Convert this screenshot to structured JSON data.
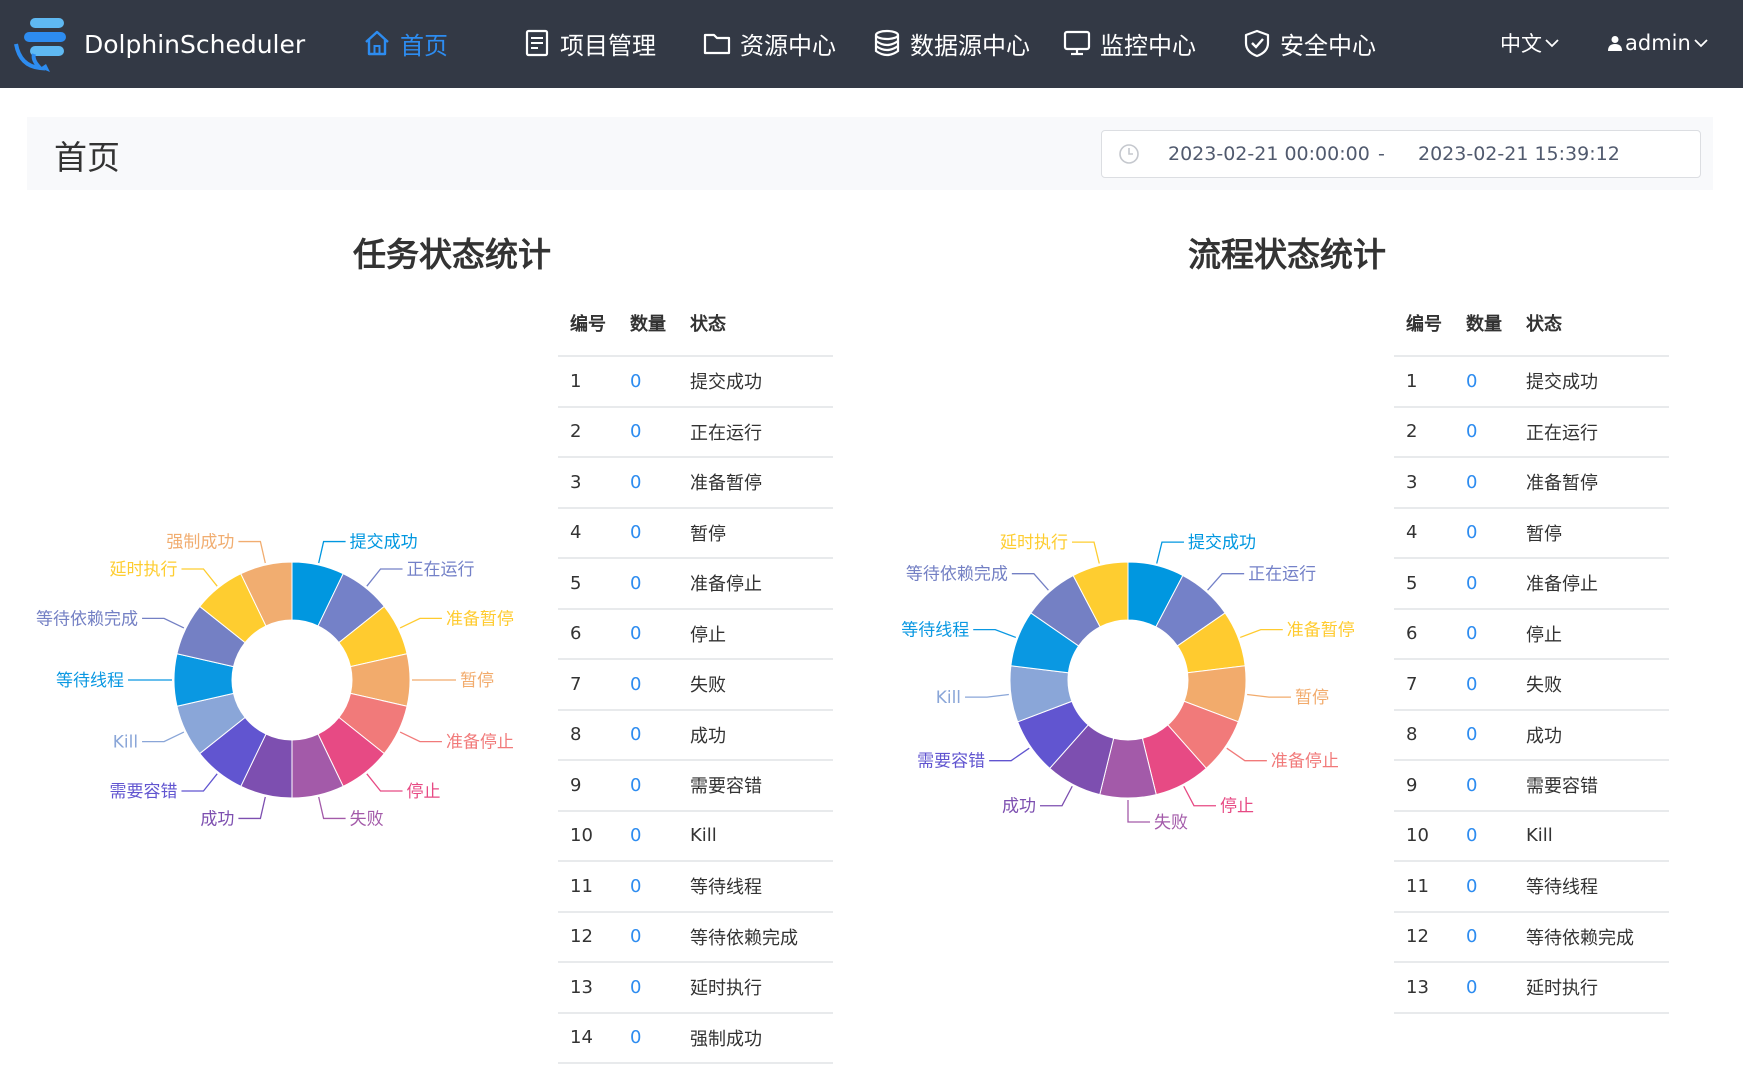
{
  "app": {
    "name": "DolphinScheduler"
  },
  "nav": {
    "items": [
      {
        "label": "首页",
        "icon": "home-icon"
      },
      {
        "label": "项目管理",
        "icon": "project-icon"
      },
      {
        "label": "资源中心",
        "icon": "folder-icon"
      },
      {
        "label": "数据源中心",
        "icon": "database-icon"
      },
      {
        "label": "监控中心",
        "icon": "monitor-icon"
      },
      {
        "label": "安全中心",
        "icon": "shield-icon"
      }
    ],
    "language": "中文",
    "user": "admin",
    "active_color": "#2d8cf0",
    "bg_color": "#333945"
  },
  "page": {
    "title": "首页",
    "date_start": "2023-02-21 00:00:00",
    "date_separator": "-",
    "date_end": "2023-02-21 15:39:12"
  },
  "task_section": {
    "title": "任务状态统计",
    "table_headers": [
      "编号",
      "数量",
      "状态"
    ],
    "rows": [
      {
        "id": "1",
        "count": "0",
        "status": "提交成功"
      },
      {
        "id": "2",
        "count": "0",
        "status": "正在运行"
      },
      {
        "id": "3",
        "count": "0",
        "status": "准备暂停"
      },
      {
        "id": "4",
        "count": "0",
        "status": "暂停"
      },
      {
        "id": "5",
        "count": "0",
        "status": "准备停止"
      },
      {
        "id": "6",
        "count": "0",
        "status": "停止"
      },
      {
        "id": "7",
        "count": "0",
        "status": "失败"
      },
      {
        "id": "8",
        "count": "0",
        "status": "成功"
      },
      {
        "id": "9",
        "count": "0",
        "status": "需要容错"
      },
      {
        "id": "10",
        "count": "0",
        "status": "Kill"
      },
      {
        "id": "11",
        "count": "0",
        "status": "等待线程"
      },
      {
        "id": "12",
        "count": "0",
        "status": "等待依赖完成"
      },
      {
        "id": "13",
        "count": "0",
        "status": "延时执行"
      },
      {
        "id": "14",
        "count": "0",
        "status": "强制成功"
      }
    ],
    "chart_labels": [
      "提交成功",
      "正在运行",
      "准备暂停",
      "暂停",
      "准备停止",
      "停止",
      "失败",
      "成功",
      "需要容错",
      "Kill",
      "等待线程",
      "等待依赖完成",
      "延时执行",
      "强制成功"
    ]
  },
  "process_section": {
    "title": "流程状态统计",
    "table_headers": [
      "编号",
      "数量",
      "状态"
    ],
    "rows": [
      {
        "id": "1",
        "count": "0",
        "status": "提交成功"
      },
      {
        "id": "2",
        "count": "0",
        "status": "正在运行"
      },
      {
        "id": "3",
        "count": "0",
        "status": "准备暂停"
      },
      {
        "id": "4",
        "count": "0",
        "status": "暂停"
      },
      {
        "id": "5",
        "count": "0",
        "status": "准备停止"
      },
      {
        "id": "6",
        "count": "0",
        "status": "停止"
      },
      {
        "id": "7",
        "count": "0",
        "status": "失败"
      },
      {
        "id": "8",
        "count": "0",
        "status": "成功"
      },
      {
        "id": "9",
        "count": "0",
        "status": "需要容错"
      },
      {
        "id": "10",
        "count": "0",
        "status": "Kill"
      },
      {
        "id": "11",
        "count": "0",
        "status": "等待线程"
      },
      {
        "id": "12",
        "count": "0",
        "status": "等待依赖完成"
      },
      {
        "id": "13",
        "count": "0",
        "status": "延时执行"
      }
    ],
    "chart_labels": [
      "提交成功",
      "正在运行",
      "准备暂停",
      "暂停",
      "准备停止",
      "停止",
      "失败",
      "成功",
      "需要容错",
      "Kill",
      "等待线程",
      "等待依赖完成",
      "延时执行"
    ]
  },
  "chart_palette": [
    "#0097e0",
    "#7481c8",
    "#ffcb2f",
    "#f2ab6c",
    "#f17a7a",
    "#e74a84",
    "#a35aa9",
    "#7d4fb0",
    "#6155d0",
    "#8aa6d8",
    "#0a98e2",
    "#7480c4",
    "#fecd30",
    "#f1ad70"
  ],
  "chart_data": [
    {
      "type": "pie",
      "title": "任务状态统计",
      "categories": [
        "提交成功",
        "正在运行",
        "准备暂停",
        "暂停",
        "准备停止",
        "停止",
        "失败",
        "成功",
        "需要容错",
        "Kill",
        "等待线程",
        "等待依赖完成",
        "延时执行",
        "强制成功"
      ],
      "values": [
        0,
        0,
        0,
        0,
        0,
        0,
        0,
        0,
        0,
        0,
        0,
        0,
        0,
        0
      ]
    },
    {
      "type": "pie",
      "title": "流程状态统计",
      "categories": [
        "提交成功",
        "正在运行",
        "准备暂停",
        "暂停",
        "准备停止",
        "停止",
        "失败",
        "成功",
        "需要容错",
        "Kill",
        "等待线程",
        "等待依赖完成",
        "延时执行"
      ],
      "values": [
        0,
        0,
        0,
        0,
        0,
        0,
        0,
        0,
        0,
        0,
        0,
        0,
        0
      ]
    }
  ]
}
